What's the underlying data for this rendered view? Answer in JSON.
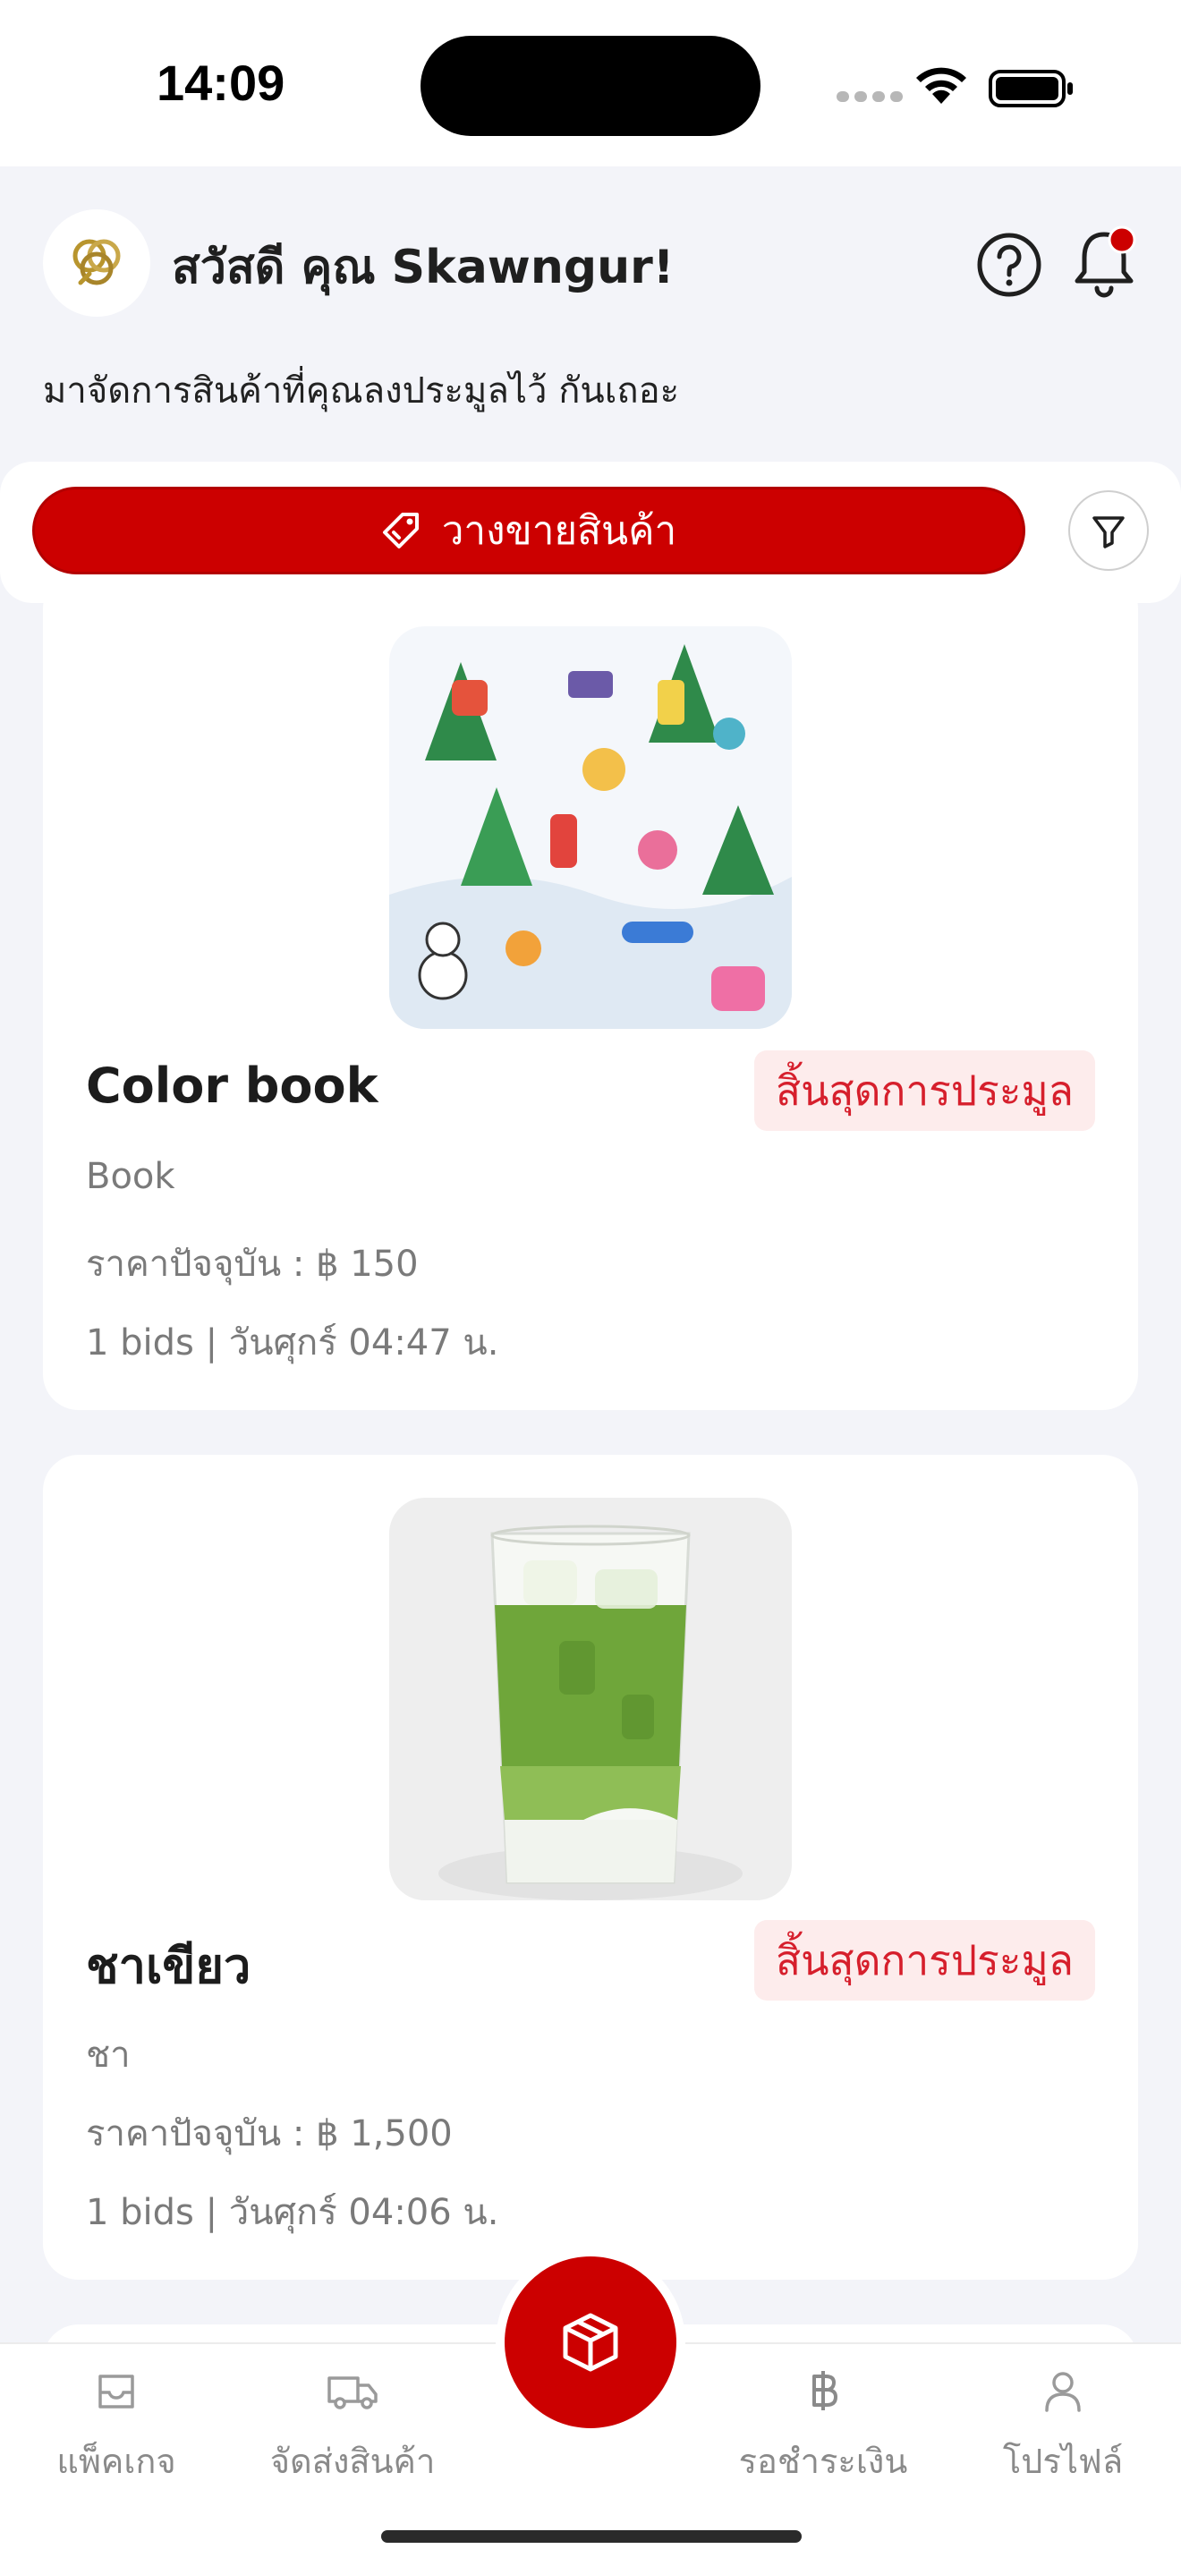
{
  "status_bar": {
    "time": "14:09"
  },
  "header": {
    "greeting": "สวัสดี คุณ Skawngur!",
    "subtitle": "มาจัดการสินค้าที่คุณลงประมูลไว้ กันเถอะ",
    "has_notification": true
  },
  "actions": {
    "sell_label": "วางขายสินค้า"
  },
  "products": [
    {
      "title": "Color book",
      "status": "สิ้นสุดการประมูล",
      "category": "Book",
      "price": "ราคาปัจจุบัน : ฿ 150",
      "meta": "1 bids | วันศุกร์ 04:47 น."
    },
    {
      "title": "ชาเขียว",
      "status": "สิ้นสุดการประมูล",
      "category": "ชา",
      "price": "ราคาปัจจุบัน : ฿ 1,500",
      "meta": "1 bids | วันศุกร์ 04:06 น."
    }
  ],
  "nav": {
    "packages": "แพ็คเกจ",
    "shipping": "จัดส่งสินค้า",
    "payment": "รอชำระเงิน",
    "profile": "โปรไฟล์"
  },
  "colors": {
    "brand_red": "#cc0000",
    "badge_bg": "#fdecec",
    "badge_text": "#d61f2c",
    "page_bg": "#f3f4f9"
  }
}
